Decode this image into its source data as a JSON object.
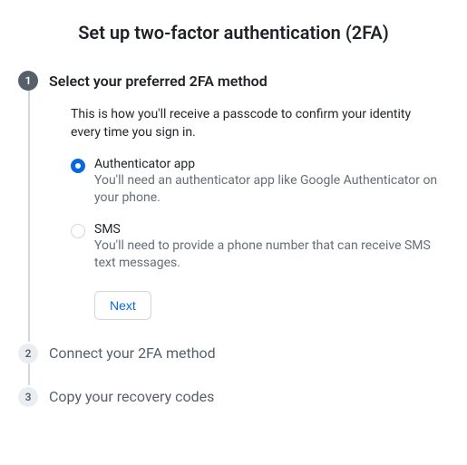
{
  "title": "Set up two-factor authentication (2FA)",
  "steps": {
    "s1": {
      "num": "1",
      "title": "Select your preferred 2FA method",
      "desc": "This is how you'll receive a passcode to confirm your identity every time you sign in.",
      "options": {
        "authenticator": {
          "label": "Authenticator app",
          "desc": "You'll need an authenticator app like Google Authenticator on your phone."
        },
        "sms": {
          "label": "SMS",
          "desc": "You'll need to provide a phone number that can receive SMS text messages."
        }
      },
      "next": "Next"
    },
    "s2": {
      "num": "2",
      "title": "Connect your 2FA method"
    },
    "s3": {
      "num": "3",
      "title": "Copy your recovery codes"
    }
  }
}
